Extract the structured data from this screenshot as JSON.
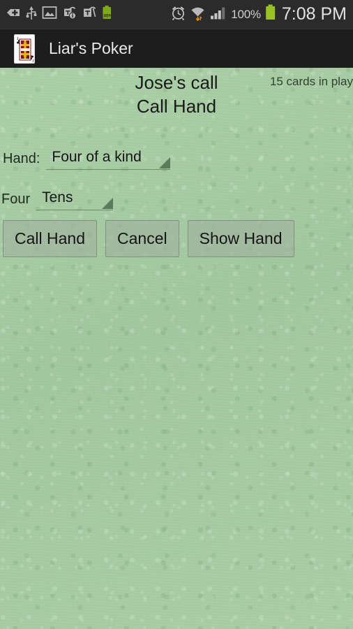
{
  "statusbar": {
    "icons_left": [
      {
        "name": "vpn-key-icon",
        "label": "vpn"
      },
      {
        "name": "usb-icon",
        "label": "usb"
      },
      {
        "name": "screenshot-image-icon",
        "label": "image"
      },
      {
        "name": "t-mobile-info-icon",
        "label": "tmobile-info"
      },
      {
        "name": "t-mobile-icon",
        "label": "tmobile"
      },
      {
        "name": "battery-small-icon",
        "label": "100%"
      }
    ],
    "icons_right": [
      {
        "name": "alarm-clock-icon",
        "label": "alarm"
      },
      {
        "name": "wifi-icon",
        "label": "wifi"
      },
      {
        "name": "cell-signal-icon",
        "label": "signal"
      }
    ],
    "battery_percent": "100%",
    "clock": "7:08 PM",
    "small_battery_label": "100%"
  },
  "titlebar": {
    "app_icon_name": "jack-of-clubs-card-icon",
    "title": "Liar's Poker"
  },
  "main": {
    "turn_label": "Jose's call",
    "screen_title": "Call Hand",
    "cards_in_play": "15 cards in play",
    "fields": [
      {
        "id": "hand",
        "label": "Hand:",
        "value": "Four of a kind",
        "arrow_icon": "spinner-dropdown-arrow-icon"
      },
      {
        "id": "four",
        "label": "Four",
        "value": "Tens",
        "arrow_icon": "spinner-dropdown-arrow-icon"
      }
    ],
    "buttons": [
      {
        "id": "call-hand",
        "label": "Call Hand"
      },
      {
        "id": "cancel",
        "label": "Cancel"
      },
      {
        "id": "show-hand",
        "label": "Show Hand"
      }
    ]
  },
  "colors": {
    "felt_green": "#a5c9a2",
    "statusbar_bg": "#2b2b2b",
    "titlebar_bg": "#1d1d1d",
    "battery_green": "#97c21f",
    "text_dark": "#1a1a1a"
  }
}
